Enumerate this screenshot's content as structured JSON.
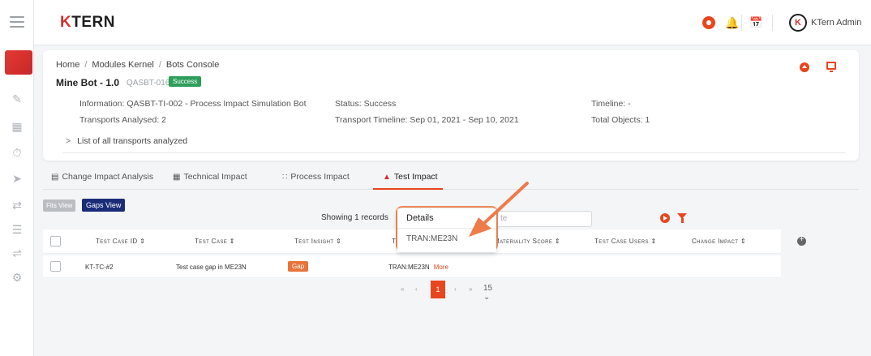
{
  "app": {
    "logo": "KTERN",
    "logo_k": "K",
    "user_name": "KTern Admin",
    "avatar": "K"
  },
  "breadcrumb": [
    "Home",
    "Modules Kernel",
    "Bots Console"
  ],
  "bot": {
    "title": "Mine Bot - 1.0",
    "id": "QASBT-016",
    "status_badge": "Success"
  },
  "info": {
    "information": "Information:  QASBT-TI-002 - Process Impact Simulation Bot",
    "status": "Status:  Success",
    "timeline": "Timeline:  -",
    "transports": "Transports Analysed:  2",
    "transport_timeline": "Transport Timeline:  Sep 01, 2021 - Sep 10, 2021",
    "total_objects": "Total Objects:  1"
  },
  "list_toggle": "List of all transports analyzed",
  "tabs": [
    {
      "label": "Change Impact Analysis",
      "icon": "chart-icon"
    },
    {
      "label": "Technical Impact",
      "icon": "grid-icon"
    },
    {
      "label": "Process Impact",
      "icon": "process-icon"
    },
    {
      "label": "Test Impact",
      "icon": "flask-icon"
    }
  ],
  "views": {
    "fits": "Fits View",
    "gaps": "Gaps View"
  },
  "showing": "Showing 1 records",
  "filter_suffix": "te",
  "table": {
    "headers": [
      "Test Case ID",
      "Test Case",
      "Test Insight",
      "T",
      "Materiality Score",
      "Test Case Users",
      "Change Impact"
    ],
    "rows": [
      {
        "id": "KT-TC-#2",
        "case": "Test case gap in ME23N",
        "insight": "Gap",
        "transport": "TRAN:ME23N",
        "more": "More"
      }
    ]
  },
  "pager": {
    "first": "«",
    "prev": "‹",
    "page": "1",
    "next": "›",
    "last": "»",
    "size": "15"
  },
  "dropdown": {
    "title": "Details",
    "item": "TRAN:ME23N"
  },
  "colors": {
    "accent": "#e8461e",
    "success": "#2e9e5b",
    "navy": "#1a2c78"
  }
}
